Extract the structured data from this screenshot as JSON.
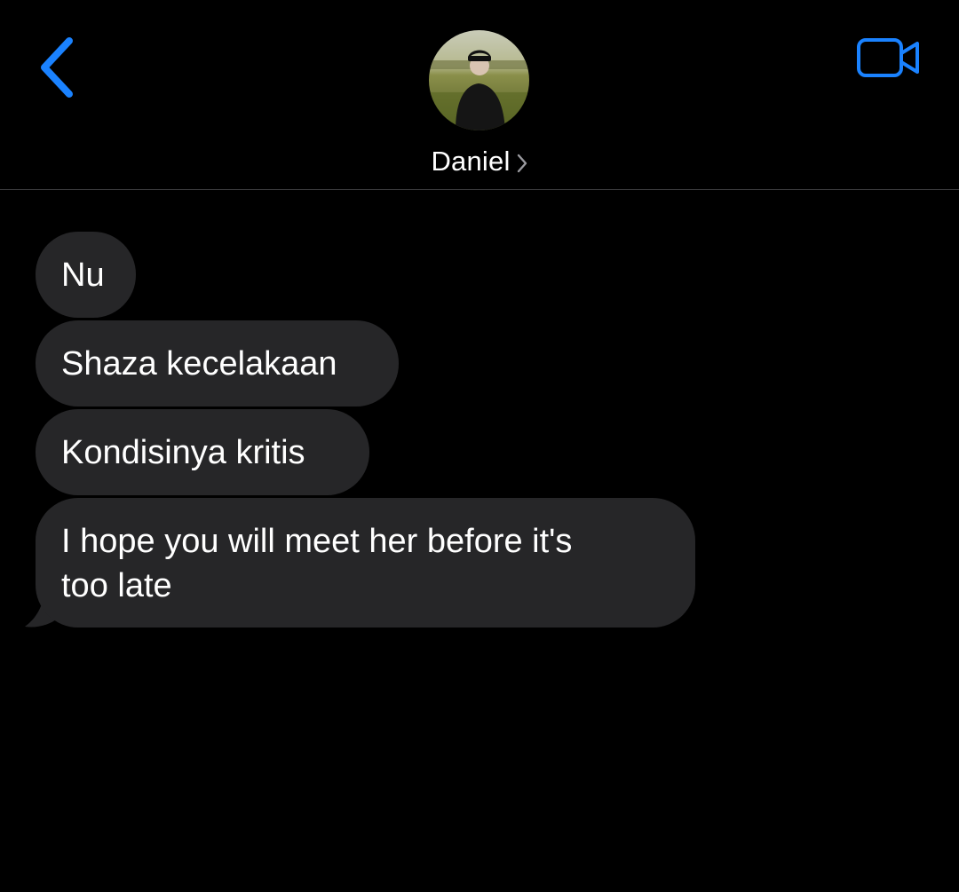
{
  "header": {
    "back_icon": "chevron-left-icon",
    "contact_name": "Daniel",
    "name_chevron_icon": "chevron-right-icon",
    "video_icon": "video-camera-icon",
    "avatar_icon": "contact-photo"
  },
  "colors": {
    "background": "#000000",
    "accent": "#1a82ff",
    "bubble_received": "#262628",
    "divider": "#38383a",
    "text": "#ffffff"
  },
  "messages": [
    {
      "direction": "received",
      "text": "Nu"
    },
    {
      "direction": "received",
      "text": "Shaza kecelakaan"
    },
    {
      "direction": "received",
      "text": "Kondisinya kritis"
    },
    {
      "direction": "received",
      "text": "I hope you will meet her before it's\ntoo late"
    }
  ]
}
